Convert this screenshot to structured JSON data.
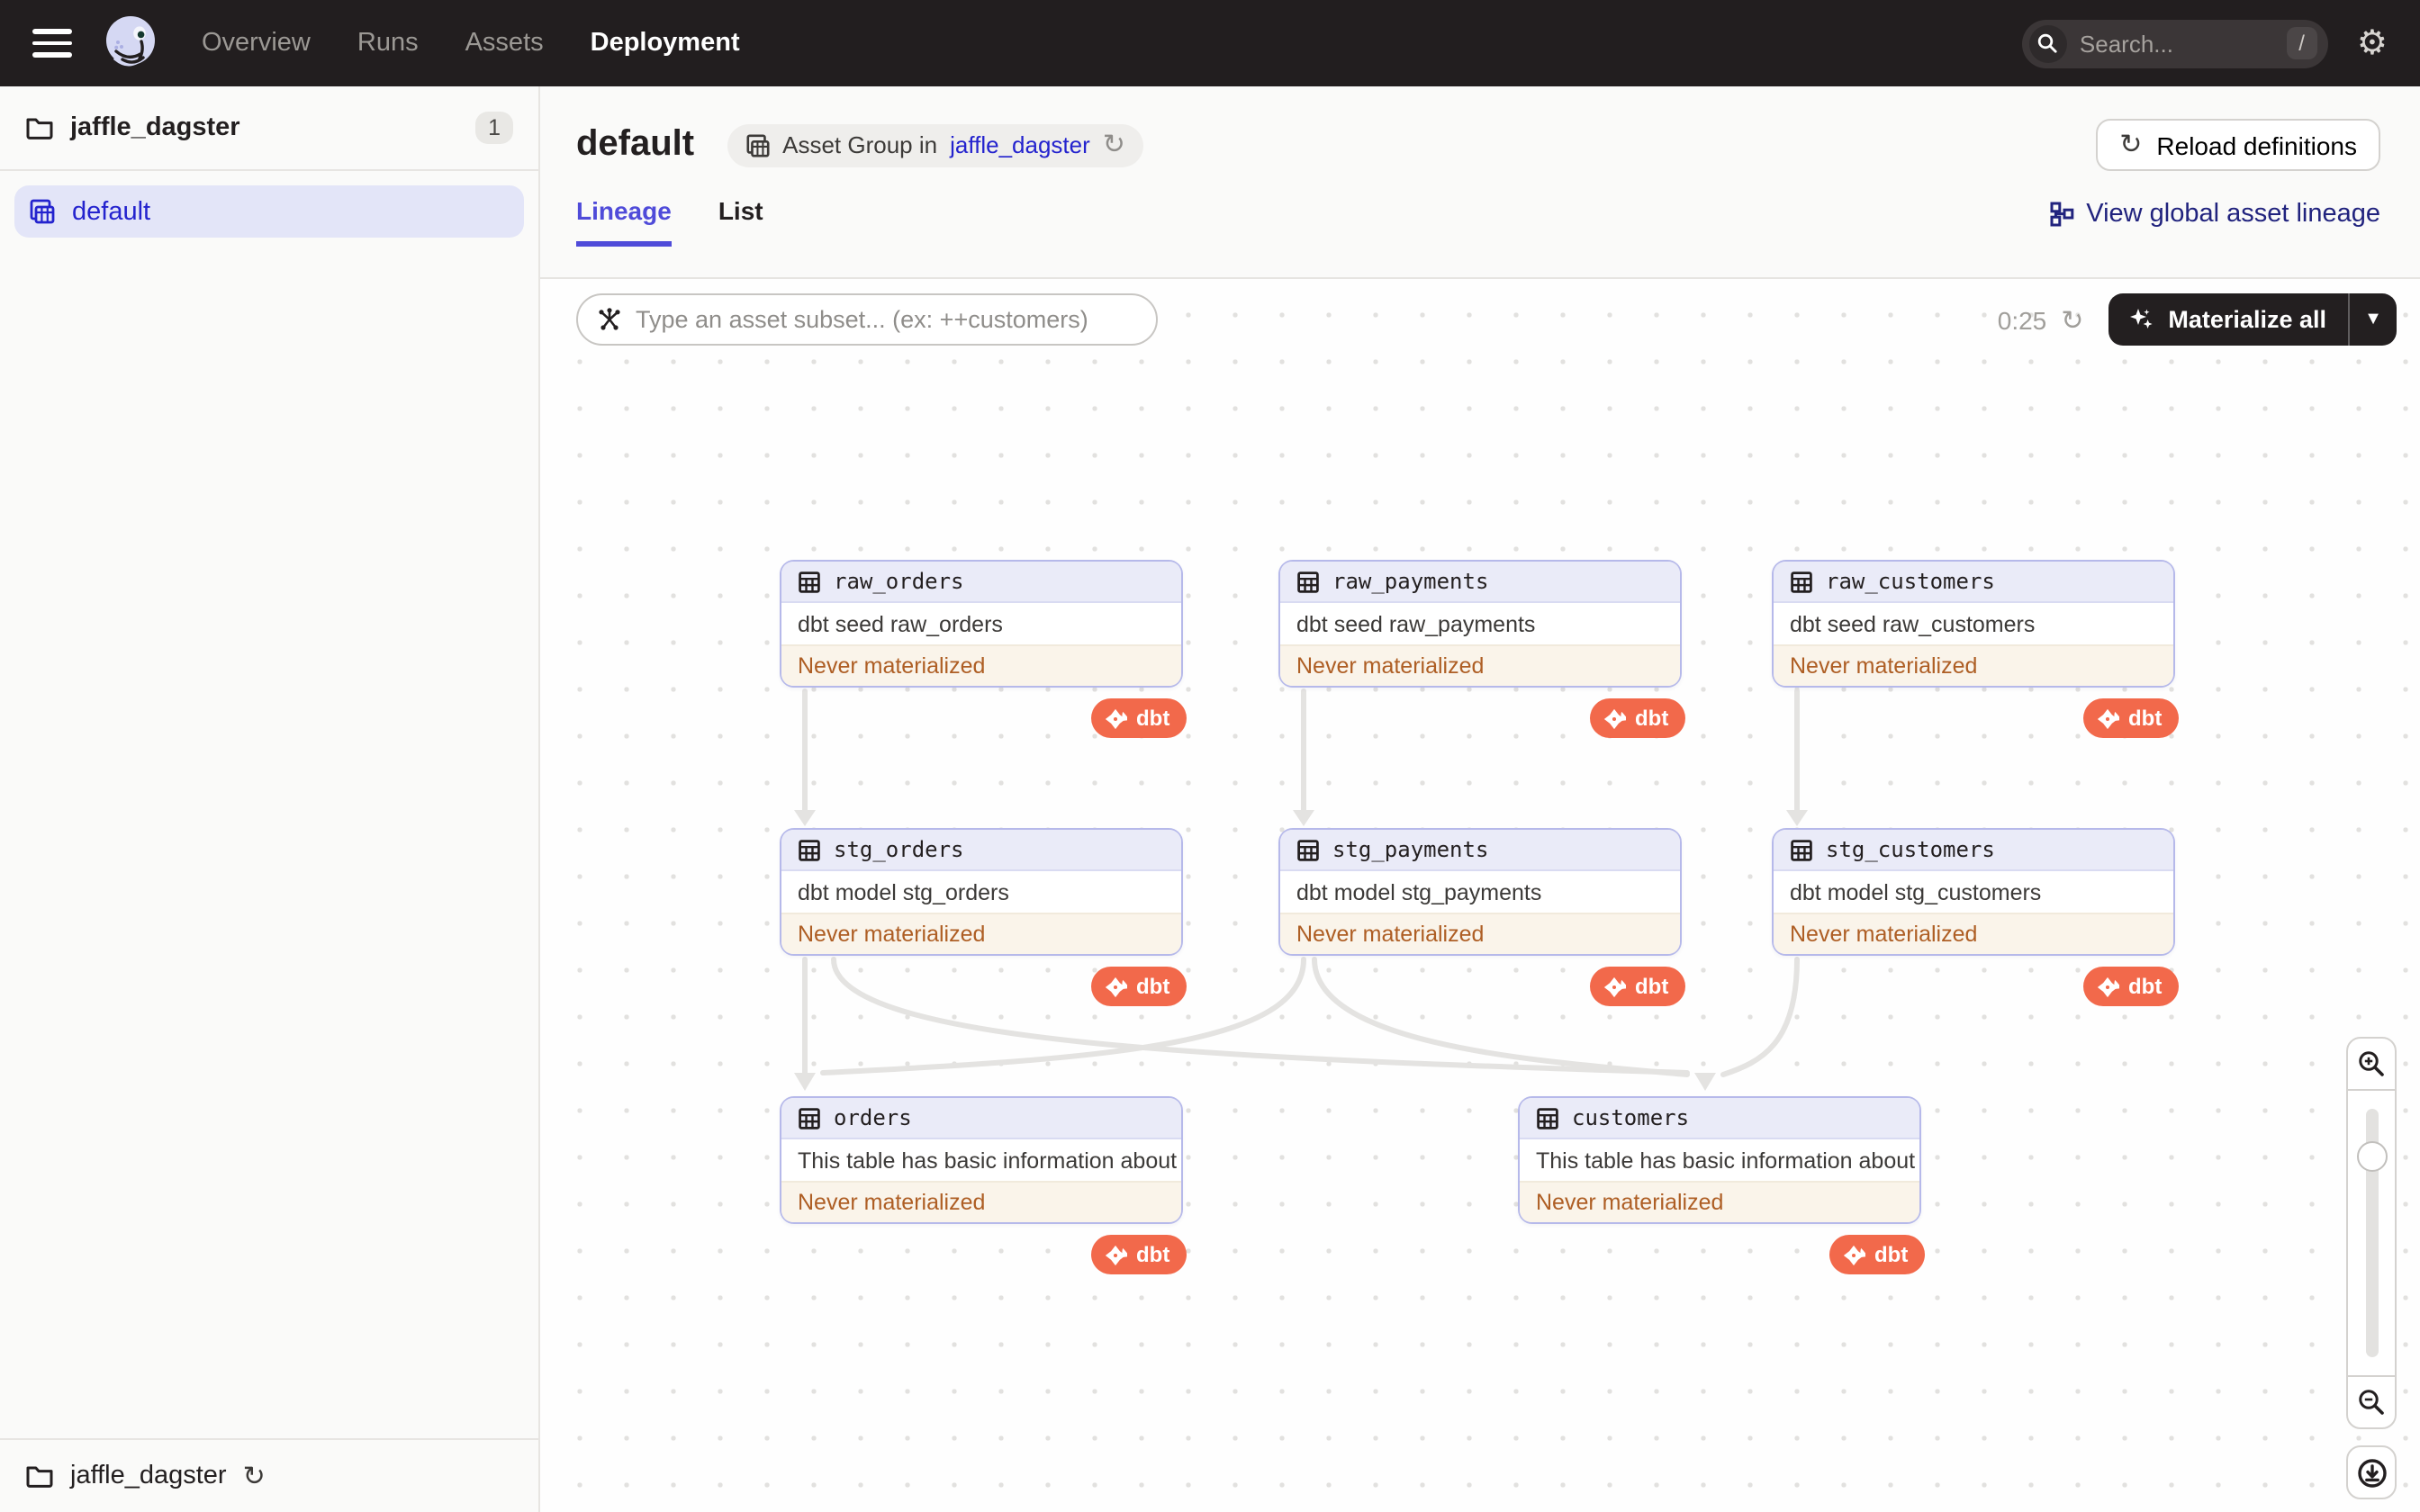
{
  "topnav": {
    "menu": [
      "Overview",
      "Runs",
      "Assets",
      "Deployment"
    ],
    "active_menu": "Deployment",
    "search_placeholder": "Search...",
    "search_shortcut": "/"
  },
  "sidebar": {
    "repo_label": "jaffle_dagster",
    "repo_count": "1",
    "selected_group": "default",
    "footer_repo": "jaffle_dagster"
  },
  "header": {
    "title": "default",
    "context_prefix": "Asset Group in",
    "context_link": "jaffle_dagster",
    "reload_label": "Reload definitions"
  },
  "tabs": {
    "lineage": "Lineage",
    "list": "List",
    "view_global": "View global asset lineage"
  },
  "toolbar": {
    "subset_placeholder": "Type an asset subset... (ex: ++customers)",
    "timer": "0:25",
    "materialize_label": "Materialize all"
  },
  "graph": {
    "status_label": "Never materialized",
    "badge_label": "dbt",
    "nodes": [
      {
        "id": "raw_orders",
        "name": "raw_orders",
        "description": "dbt seed raw_orders",
        "status": "Never materialized",
        "badge": "dbt"
      },
      {
        "id": "raw_payments",
        "name": "raw_payments",
        "description": "dbt seed raw_payments",
        "status": "Never materialized",
        "badge": "dbt"
      },
      {
        "id": "raw_customers",
        "name": "raw_customers",
        "description": "dbt seed raw_customers",
        "status": "Never materialized",
        "badge": "dbt"
      },
      {
        "id": "stg_orders",
        "name": "stg_orders",
        "description": "dbt model stg_orders",
        "status": "Never materialized",
        "badge": "dbt"
      },
      {
        "id": "stg_payments",
        "name": "stg_payments",
        "description": "dbt model stg_payments",
        "status": "Never materialized",
        "badge": "dbt"
      },
      {
        "id": "stg_customers",
        "name": "stg_customers",
        "description": "dbt model stg_customers",
        "status": "Never materialized",
        "badge": "dbt"
      },
      {
        "id": "orders",
        "name": "orders",
        "description": "This table has basic information about ...",
        "status": "Never materialized",
        "badge": "dbt"
      },
      {
        "id": "customers",
        "name": "customers",
        "description": "This table has basic information about ...",
        "status": "Never materialized",
        "badge": "dbt"
      }
    ],
    "edges": [
      [
        "raw_orders",
        "stg_orders"
      ],
      [
        "raw_payments",
        "stg_payments"
      ],
      [
        "raw_customers",
        "stg_customers"
      ],
      [
        "stg_orders",
        "orders"
      ],
      [
        "stg_orders",
        "customers"
      ],
      [
        "stg_payments",
        "orders"
      ],
      [
        "stg_payments",
        "customers"
      ],
      [
        "stg_customers",
        "customers"
      ]
    ]
  },
  "colors": {
    "accent_blurple": "#4F4BD9",
    "link_blue": "#2423CE",
    "navy_link": "#21237E",
    "status_orange": "#AE5E24",
    "dbt_coral": "#F2694B",
    "topnav_bg": "#221E1F"
  }
}
